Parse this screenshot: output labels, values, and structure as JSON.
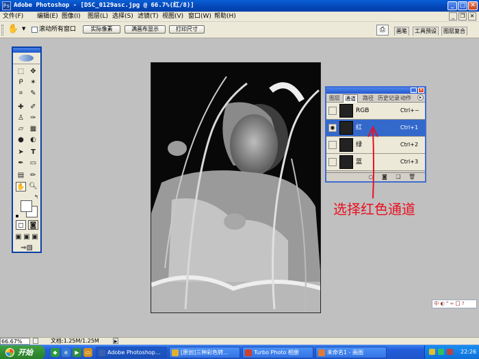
{
  "window": {
    "title": "Adobe Photoshop - [DSC_0129asc.jpg @ 66.7%(红/8)]",
    "app_icon": "Ps"
  },
  "menu": {
    "items": [
      "文件(F)",
      "编辑(E)",
      "图像(I)",
      "图层(L)",
      "选择(S)",
      "滤镜(T)",
      "视图(V)",
      "窗口(W)",
      "帮助(H)"
    ]
  },
  "options_bar": {
    "checkbox_label": "滚动所有窗口",
    "buttons": [
      "实际像素",
      "满画布显示",
      "打印尺寸"
    ]
  },
  "palette_well": {
    "tabs": [
      "画笔",
      "工具预设",
      "图层复合"
    ]
  },
  "channels_panel": {
    "tabs": [
      "图层",
      "通道",
      "路径",
      "历史记录",
      "动作"
    ],
    "channels": [
      {
        "name": "RGB",
        "shortcut": "Ctrl+~",
        "visible": true,
        "selected": false
      },
      {
        "name": "红",
        "shortcut": "Ctrl+1",
        "visible": true,
        "selected": true
      },
      {
        "name": "绿",
        "shortcut": "Ctrl+2",
        "visible": false,
        "selected": false
      },
      {
        "name": "蓝",
        "shortcut": "Ctrl+3",
        "visible": false,
        "selected": false
      }
    ]
  },
  "annotation": {
    "text": "选择红色通道",
    "color": "#e81020"
  },
  "status_bar": {
    "zoom": "66.67%",
    "doc": "文档:1.25M/1.25M"
  },
  "taskbar": {
    "start_label": "开始",
    "tasks": [
      "Adobe Photoshop...",
      "[原创]三种彩色转...",
      "Turbo Photo 相册",
      "未命名1 - 画图"
    ],
    "clock": "22:26"
  }
}
